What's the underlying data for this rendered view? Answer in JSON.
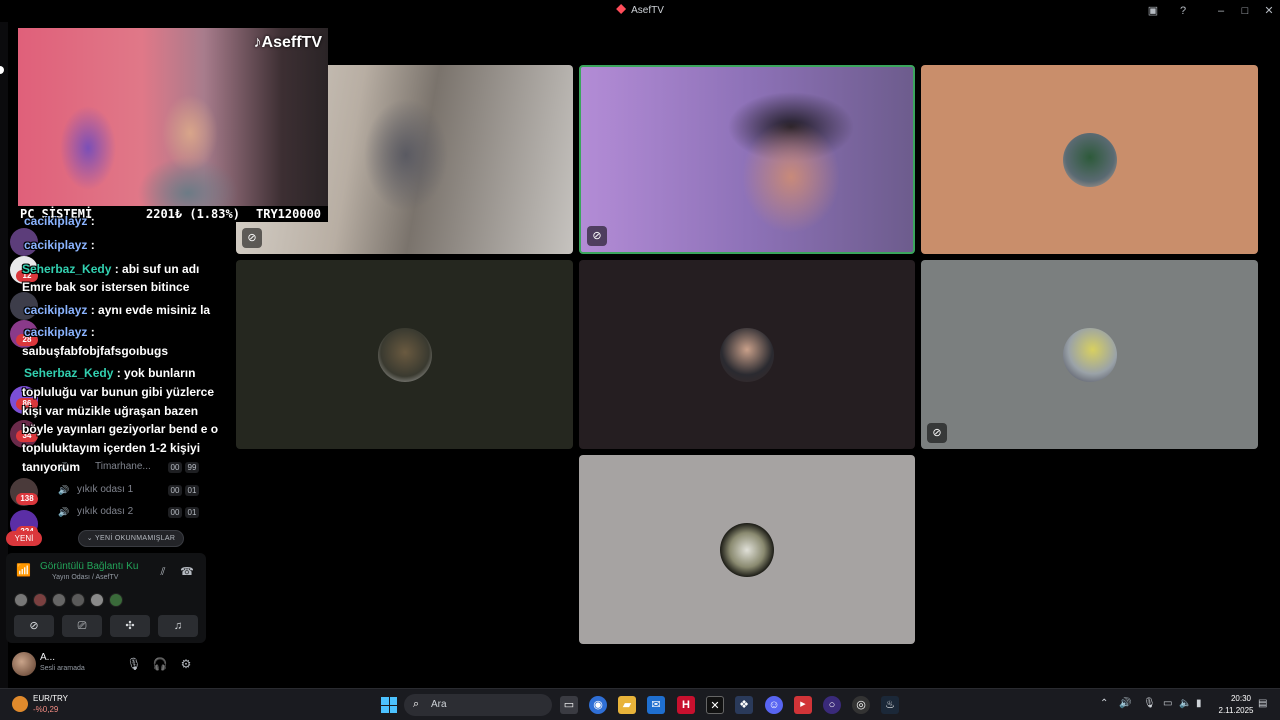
{
  "window": {
    "title": "AsefTV"
  },
  "webcam": {
    "handle": "AseffTV",
    "ticker": {
      "name": "PC SİSTEMİ",
      "price": "2201₺ (1.83%)",
      "goal": "TRY120000"
    }
  },
  "chat": [
    {
      "user": "cacikiplayz",
      "sep": " :",
      "text": ""
    },
    {
      "user": "Seherbaz_Kedy",
      "sep": " :",
      "text": " abi suf un adı"
    },
    {
      "user": "",
      "sep": "",
      "text": "Emre bak sor istersen bitince"
    },
    {
      "user": "cacikiplayz",
      "sep": " :",
      "text": " aynı evde misiniz la"
    },
    {
      "user": "cacikiplayz",
      "sep": " :",
      "text": ""
    },
    {
      "user": "",
      "sep": "",
      "text": "saıbuşfabfobjfafsgoıbugs"
    },
    {
      "user": "Seherbaz_Kedy",
      "sep": " :",
      "text": " yok bunların"
    },
    {
      "user": "",
      "sep": "",
      "text": "topluluğu var bunun gibi yüzlerce"
    },
    {
      "user": "",
      "sep": "",
      "text": "kişi var müzikle uğraşan bazen"
    },
    {
      "user": "",
      "sep": "",
      "text": "böyle yayınları geziyorlar bend e o"
    },
    {
      "user": "",
      "sep": "",
      "text": "topluluktayım içerden 1-2 kişiyi"
    },
    {
      "user": "",
      "sep": "",
      "text": "tanıyorum"
    }
  ],
  "channels": [
    {
      "name": "Timarhane...",
      "a": "00",
      "b": "99"
    },
    {
      "name": "yıkık odası 1",
      "a": "00",
      "b": "01"
    },
    {
      "name": "yıkık odası 2",
      "a": "00",
      "b": "01"
    }
  ],
  "server_badges": [
    "12",
    "28",
    "86",
    "34",
    "138",
    "224"
  ],
  "new_pill": "YENİ",
  "unread_label": "⌄ YENİ OKUNMAMIŞLAR",
  "voice": {
    "title": "Görüntülü Bağlantı Ku",
    "subtitle": "Yayın Odası / AsefTV"
  },
  "user": {
    "name": "A...",
    "status": "Sesli aramada"
  },
  "taskbar": {
    "fx_pair": "EUR/TRY",
    "fx_change": "-%0,29",
    "search_placeholder": "Ara",
    "time": "20:30",
    "date": "2.11.2025"
  },
  "colors": {
    "speaking": "#3ba55d",
    "accent": "#5865f2"
  }
}
